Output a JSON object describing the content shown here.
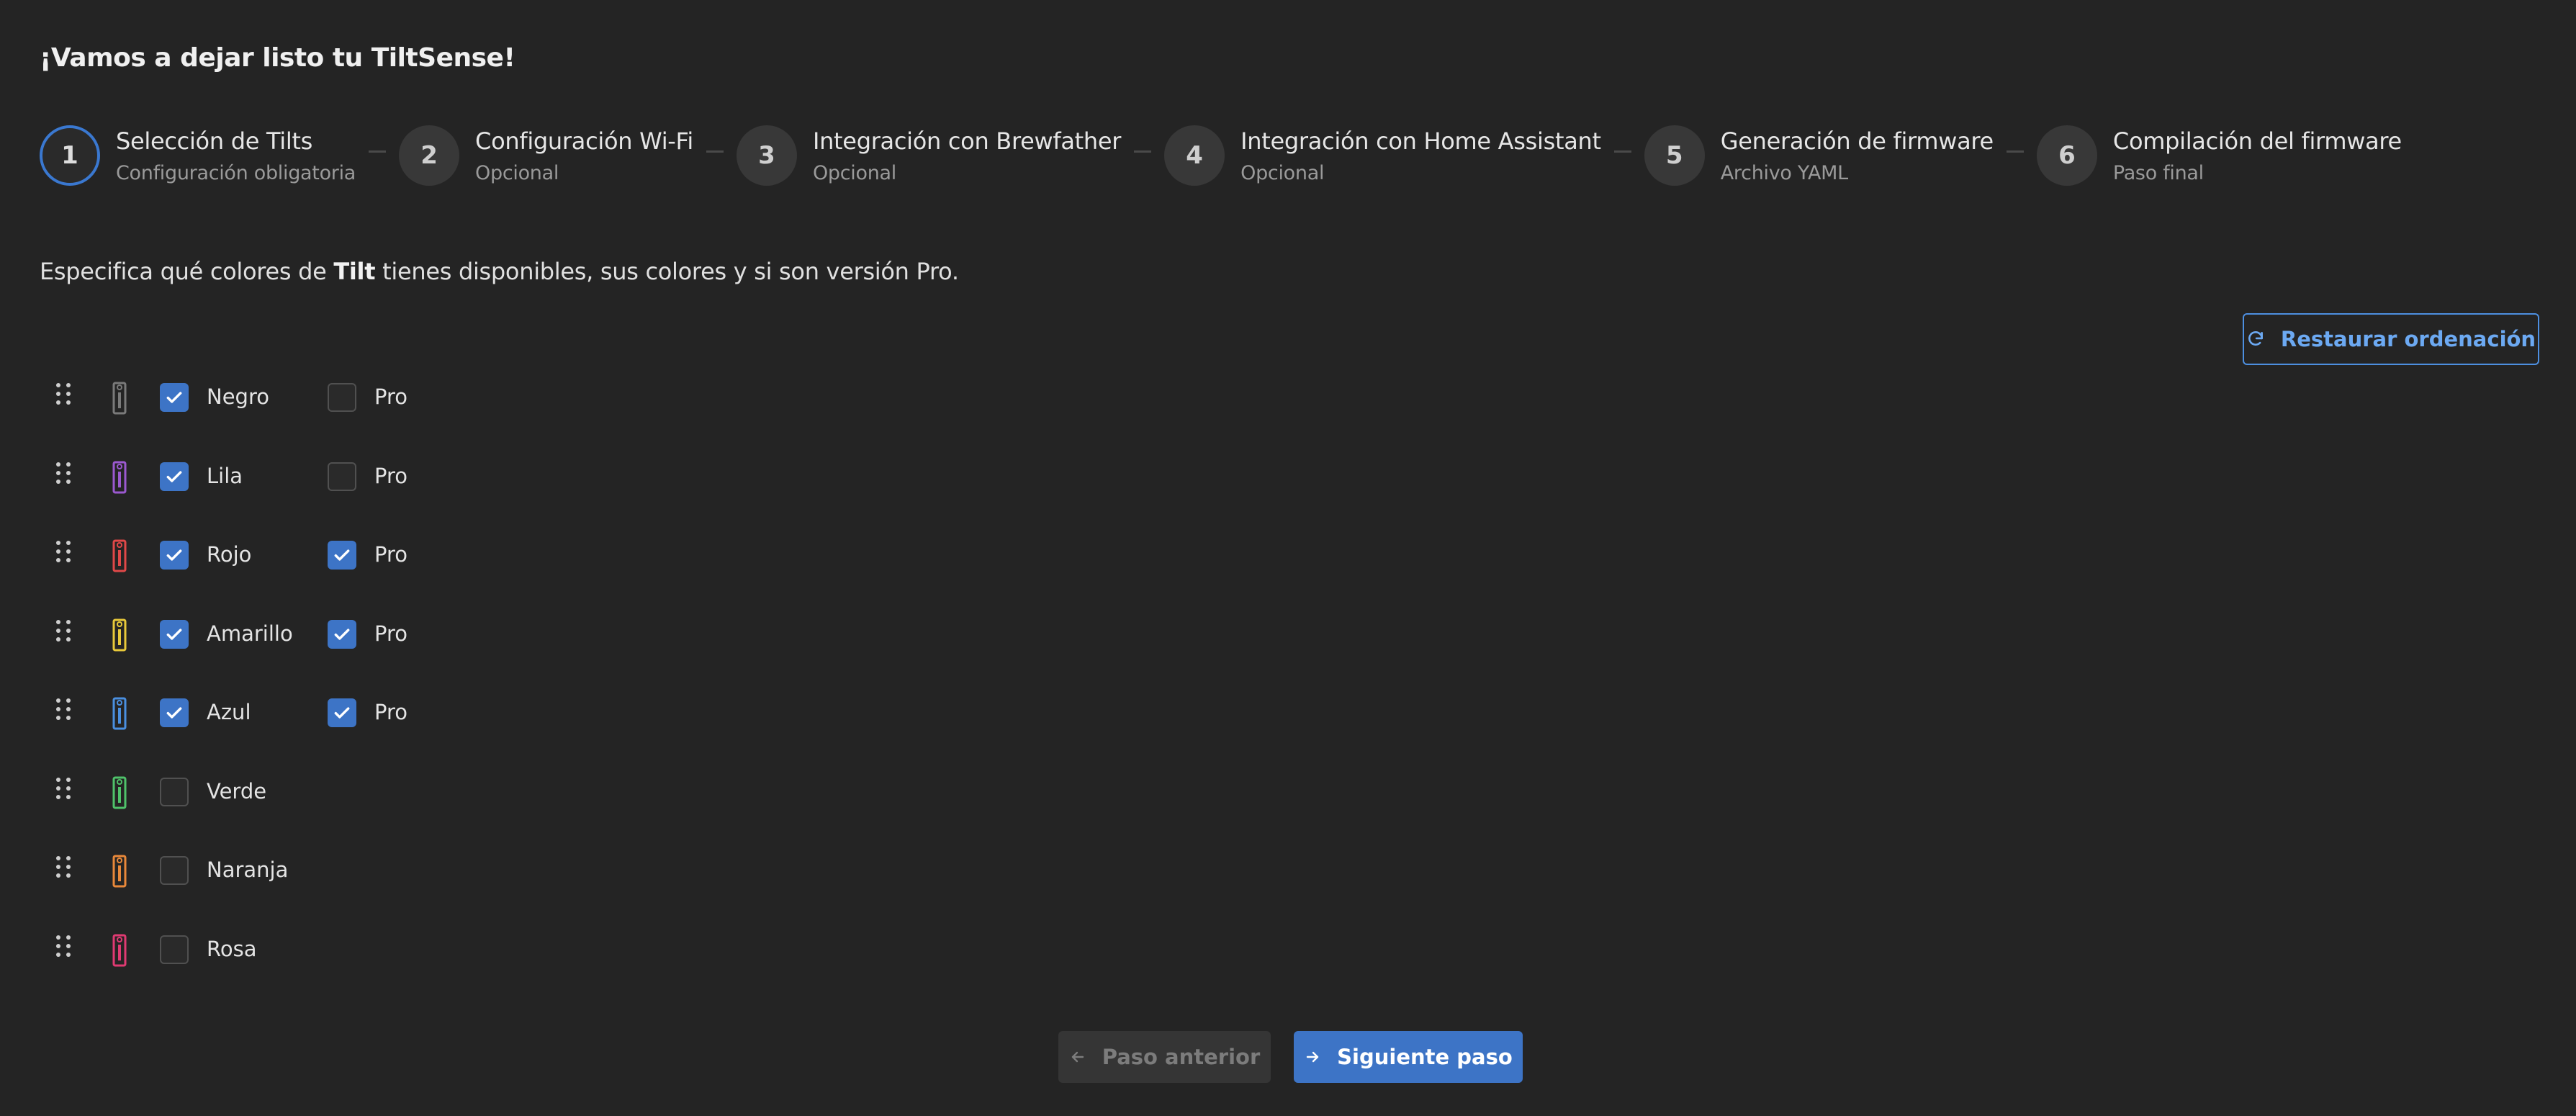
{
  "page": {
    "title": "¡Vamos a dejar listo tu TiltSense!"
  },
  "stepper": {
    "steps": [
      {
        "number": "1",
        "label": "Selección de Tilts",
        "description": "Configuración obligatoria",
        "active": true
      },
      {
        "number": "2",
        "label": "Configuración Wi-Fi",
        "description": "Opcional",
        "active": false
      },
      {
        "number": "3",
        "label": "Integración con Brewfather",
        "description": "Opcional",
        "active": false
      },
      {
        "number": "4",
        "label": "Integración con Home Assistant",
        "description": "Opcional",
        "active": false
      },
      {
        "number": "5",
        "label": "Generación de firmware",
        "description": "Archivo YAML",
        "active": false
      },
      {
        "number": "6",
        "label": "Compilación del firmware",
        "description": "Paso final",
        "active": false
      }
    ]
  },
  "instructions": {
    "before": "Especifica qué colores de ",
    "bold": "Tilt",
    "after": " tienes disponibles, sus colores y si son versión Pro."
  },
  "restore_button": {
    "label": "Restaurar ordenación",
    "icon": "refresh-icon"
  },
  "tilts": [
    {
      "name": "Negro",
      "color": "#7a7a7a",
      "selected": true,
      "pro": false,
      "pro_label": "Pro"
    },
    {
      "name": "Lila",
      "color": "#9b59d0",
      "selected": true,
      "pro": false,
      "pro_label": "Pro"
    },
    {
      "name": "Rojo",
      "color": "#e04848",
      "selected": true,
      "pro": true,
      "pro_label": "Pro"
    },
    {
      "name": "Amarillo",
      "color": "#e8c93a",
      "selected": true,
      "pro": true,
      "pro_label": "Pro"
    },
    {
      "name": "Azul",
      "color": "#4a8fe0",
      "selected": true,
      "pro": true,
      "pro_label": "Pro"
    },
    {
      "name": "Verde",
      "color": "#4fc26a",
      "selected": false,
      "pro": false,
      "pro_label": ""
    },
    {
      "name": "Naranja",
      "color": "#e8883a",
      "selected": false,
      "pro": false,
      "pro_label": ""
    },
    {
      "name": "Rosa",
      "color": "#e03a72",
      "selected": false,
      "pro": false,
      "pro_label": ""
    }
  ],
  "navigation": {
    "prev_label": "Paso anterior",
    "next_label": "Siguiente paso",
    "prev_icon": "arrow-left-icon",
    "next_icon": "arrow-right-icon"
  }
}
